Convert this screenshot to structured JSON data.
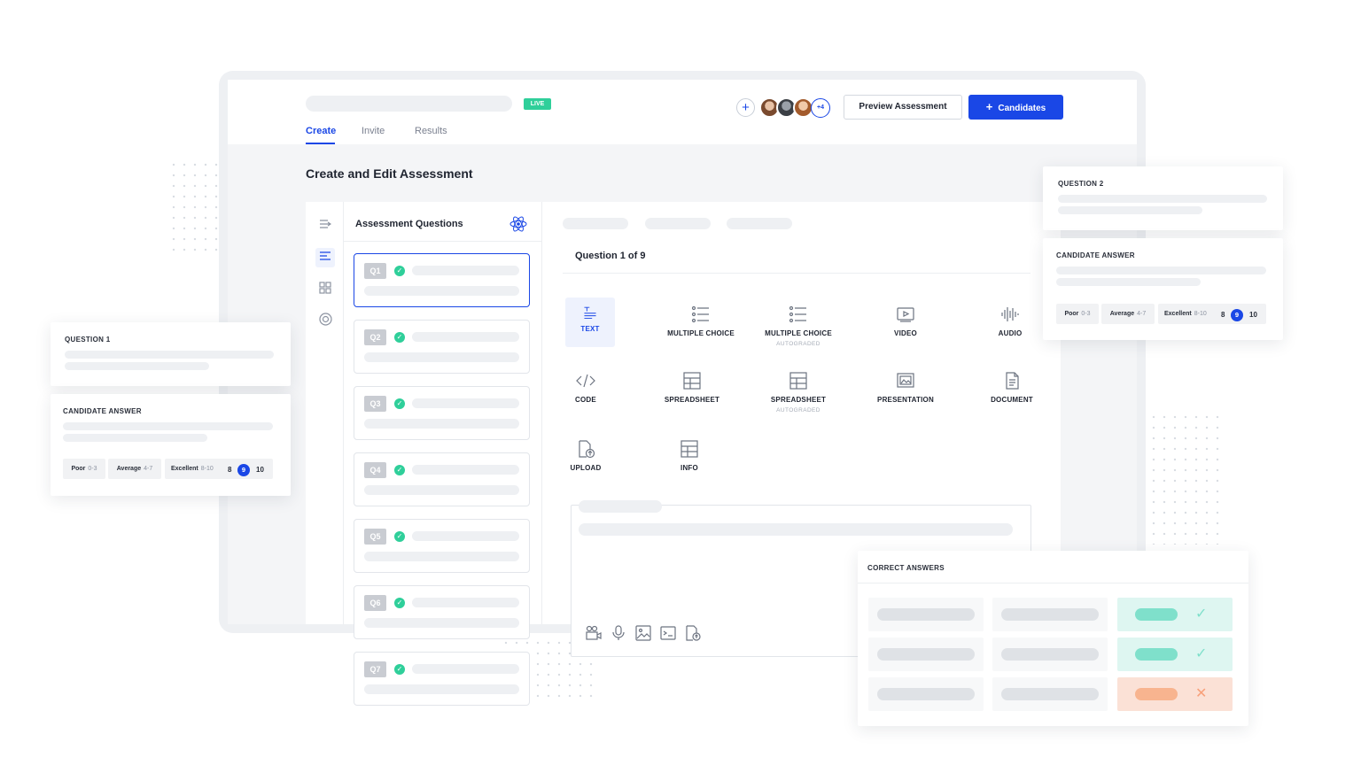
{
  "header": {
    "live_badge": "LIVE",
    "tabs": [
      "Create",
      "Invite",
      "Results"
    ],
    "add_collaborator": "+",
    "more_collaborators": "+4",
    "preview_button": "Preview Assessment",
    "candidates_button": "Candidates",
    "candidates_icon": "+"
  },
  "page": {
    "title": "Create and Edit Assessment"
  },
  "questions_panel": {
    "title": "Assessment Questions",
    "items": [
      "Q1",
      "Q2",
      "Q3",
      "Q4",
      "Q5",
      "Q6",
      "Q7"
    ],
    "check": "✓"
  },
  "editor": {
    "question_counter": "Question 1 of 9",
    "types": [
      {
        "label": "TEXT",
        "sub": "",
        "icon": "text-icon"
      },
      {
        "label": "MULTIPLE CHOICE",
        "sub": "",
        "icon": "list-icon"
      },
      {
        "label": "MULTIPLE CHOICE",
        "sub": "AUTOGRADED",
        "icon": "list-icon"
      },
      {
        "label": "VIDEO",
        "sub": "",
        "icon": "video-icon"
      },
      {
        "label": "AUDIO",
        "sub": "",
        "icon": "audio-icon"
      },
      {
        "label": "CODE",
        "sub": "",
        "icon": "code-icon"
      },
      {
        "label": "SPREADSHEET",
        "sub": "",
        "icon": "spreadsheet-icon"
      },
      {
        "label": "SPREADSHEET",
        "sub": "AUTOGRADED",
        "icon": "spreadsheet-icon"
      },
      {
        "label": "PRESENTATION",
        "sub": "",
        "icon": "presentation-icon"
      },
      {
        "label": "DOCUMENT",
        "sub": "",
        "icon": "document-icon"
      },
      {
        "label": "UPLOAD",
        "sub": "",
        "icon": "upload-icon"
      },
      {
        "label": "INFO",
        "sub": "",
        "icon": "info-table-icon"
      }
    ]
  },
  "question1_card": {
    "question_label": "QUESTION 1",
    "answer_label": "CANDIDATE ANSWER",
    "ratings": {
      "poor": "Poor",
      "poor_range": "0-3",
      "average": "Average",
      "average_range": "4-7",
      "excellent": "Excellent",
      "excellent_range": "8-10"
    },
    "scores": [
      "8",
      "9",
      "10"
    ],
    "selected_score": "9"
  },
  "question2_card": {
    "question_label": "QUESTION 2",
    "answer_label": "CANDIDATE ANSWER",
    "ratings": {
      "poor": "Poor",
      "poor_range": "0-3",
      "average": "Average",
      "average_range": "4-7",
      "excellent": "Excellent",
      "excellent_range": "8-10"
    },
    "scores": [
      "8",
      "9",
      "10"
    ],
    "selected_score": "9"
  },
  "correct_answers_card": {
    "label": "CORRECT ANSWERS",
    "rows": [
      {
        "result": "correct",
        "mark": "✓"
      },
      {
        "result": "correct",
        "mark": "✓"
      },
      {
        "result": "incorrect",
        "mark": "✕"
      }
    ]
  },
  "colors": {
    "accent": "#1a47e6",
    "success": "#2fcf9a",
    "error": "#f8b48f"
  }
}
